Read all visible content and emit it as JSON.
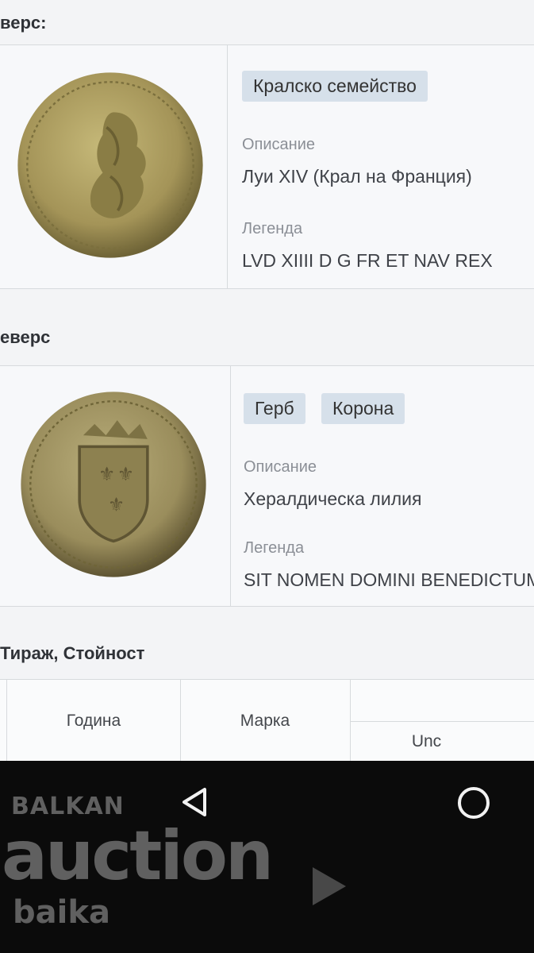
{
  "obverse": {
    "heading": "верс:",
    "tags": [
      "Кралско семейство"
    ],
    "description_label": "Описание",
    "description": "Луи XIV (Крал на Франция)",
    "legend_label": "Легенда",
    "legend": "LVD XIIII D G FR ET NAV REX"
  },
  "reverse": {
    "heading": "еверс",
    "tags": [
      "Герб",
      "Корона"
    ],
    "description_label": "Описание",
    "description": "Хералдическа лилия",
    "legend_label": "Легенда",
    "legend": "SIT NOMEN DOMINI BENEDICTUM"
  },
  "mintage": {
    "heading": "Тираж, Стойност",
    "columns": [
      "Година",
      "Марка",
      "Unc"
    ]
  },
  "watermark": {
    "line1": "BALKAN",
    "line2": "auction",
    "line3": "baika"
  },
  "colors": {
    "tag_bg": "#d6e0ea",
    "navbar_bg": "#0b0b0b",
    "coin_gold": "#a89a5e"
  }
}
